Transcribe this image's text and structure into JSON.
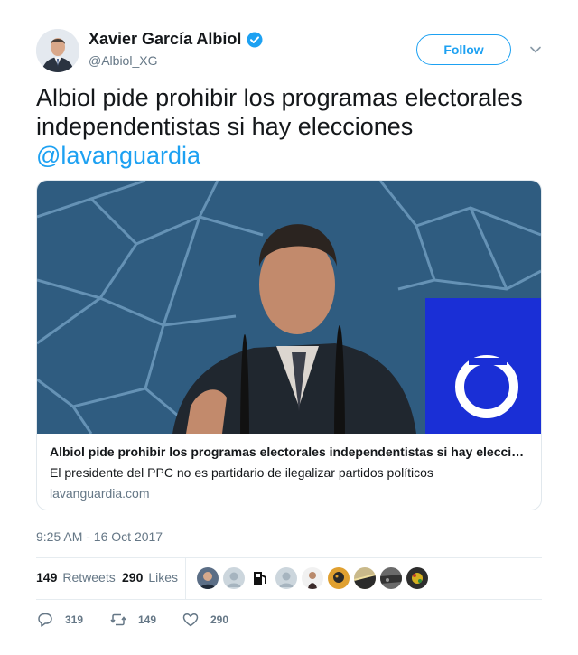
{
  "author": {
    "name": "Xavier García Albiol",
    "handle": "@Albiol_XG",
    "verified": true
  },
  "follow_label": "Follow",
  "tweet": {
    "text": "Albiol pide prohibir los programas electorales independentistas si hay elecciones",
    "mention": "@lavanguardia"
  },
  "card": {
    "title": "Albiol pide prohibir los programas electorales independentistas si hay elecciones",
    "description": "El presidente del PPC no es partidario de ilegalizar partidos políticos",
    "domain": "lavanguardia.com"
  },
  "timestamp": "9:25 AM - 16 Oct 2017",
  "stats": {
    "retweets_count": "149",
    "retweets_label": "Retweets",
    "likes_count": "290",
    "likes_label": "Likes"
  },
  "actions": {
    "reply_count": "319",
    "retweet_count": "149",
    "like_count": "290"
  },
  "colors": {
    "accent": "#1da1f2",
    "text": "#14171a",
    "secondary": "#657786",
    "border": "#e1e8ed"
  }
}
